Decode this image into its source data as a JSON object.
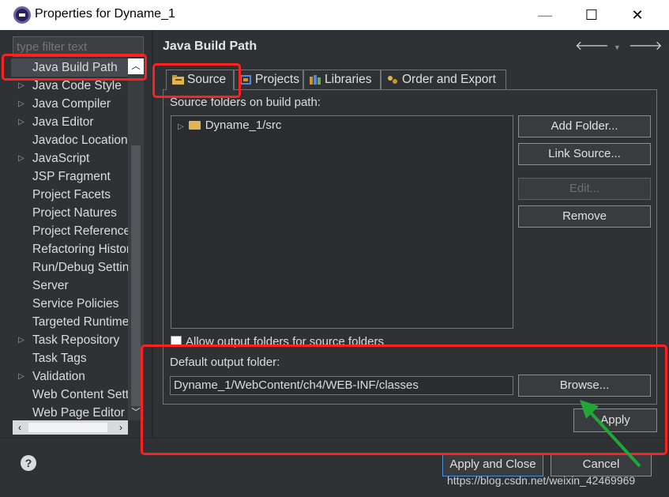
{
  "window": {
    "title": "Properties for Dyname_1",
    "min_glyph": "—",
    "max_glyph": "☐",
    "close_glyph": "✕"
  },
  "sidebar": {
    "filter_placeholder": "type filter text",
    "items": [
      {
        "label": "Java Build Path",
        "expandable": false,
        "selected": true
      },
      {
        "label": "Java Code Style",
        "expandable": true
      },
      {
        "label": "Java Compiler",
        "expandable": true
      },
      {
        "label": "Java Editor",
        "expandable": true
      },
      {
        "label": "Javadoc Location",
        "expandable": false
      },
      {
        "label": "JavaScript",
        "expandable": true
      },
      {
        "label": "JSP Fragment",
        "expandable": false
      },
      {
        "label": "Project Facets",
        "expandable": false
      },
      {
        "label": "Project Natures",
        "expandable": false
      },
      {
        "label": "Project References",
        "expandable": false
      },
      {
        "label": "Refactoring History",
        "expandable": false
      },
      {
        "label": "Run/Debug Settings",
        "expandable": false
      },
      {
        "label": "Server",
        "expandable": false
      },
      {
        "label": "Service Policies",
        "expandable": false
      },
      {
        "label": "Targeted Runtimes",
        "expandable": false
      },
      {
        "label": "Task Repository",
        "expandable": true
      },
      {
        "label": "Task Tags",
        "expandable": false
      },
      {
        "label": "Validation",
        "expandable": true
      },
      {
        "label": "Web Content Settings",
        "expandable": false
      },
      {
        "label": "Web Page Editor",
        "expandable": false
      }
    ]
  },
  "main": {
    "title": "Java Build Path",
    "tabs": [
      {
        "label": "Source",
        "active": true
      },
      {
        "label": "Projects",
        "active": false
      },
      {
        "label": "Libraries",
        "active": false
      },
      {
        "label": "Order and Export",
        "active": false
      }
    ],
    "source_folders_label": "Source folders on build path:",
    "source_folders": [
      {
        "label": "Dyname_1/src"
      }
    ],
    "buttons": {
      "add_folder": "Add Folder...",
      "link_source": "Link Source...",
      "edit": "Edit...",
      "remove": "Remove",
      "browse": "Browse...",
      "apply": "Apply"
    },
    "allow_output_label": "Allow output folders for source folders",
    "default_output_label": "Default output folder:",
    "default_output_value": "Dyname_1/WebContent/ch4/WEB-INF/classes"
  },
  "footer": {
    "help_glyph": "?",
    "apply_and_close": "Apply and Close",
    "cancel": "Cancel"
  },
  "watermark": "https://blog.csdn.net/weixin_42469969",
  "colors": {
    "background": "#2f3234",
    "highlight_box": "#ff2020",
    "arrow": "#22a638",
    "folder": "#e2b352"
  }
}
